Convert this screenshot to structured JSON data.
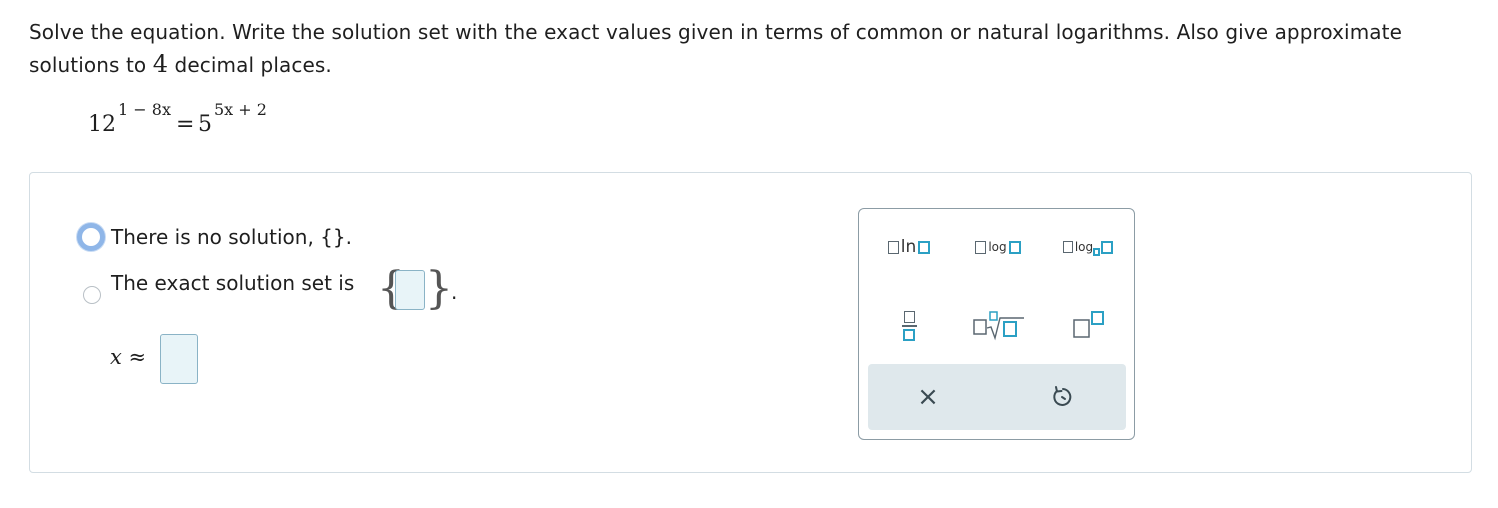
{
  "question": {
    "text_part1": "Solve the equation. Write the solution set with the exact values given in terms of common or natural logarithms. Also give approximate solutions to ",
    "decimal_count": "4",
    "text_part2": " decimal places."
  },
  "equation": {
    "left_base": "12",
    "left_exponent": "1 − 8x",
    "equals": "=",
    "right_base": "5",
    "right_exponent": "5x + 2"
  },
  "options": [
    {
      "label": "There is no solution, {}.",
      "selected": false,
      "focused": true
    },
    {
      "label": "The exact solution set is",
      "selected": false,
      "focused": false
    }
  ],
  "solution_set": {
    "value": "",
    "trailing": "."
  },
  "approx": {
    "label": "x ≈",
    "value": ""
  },
  "palette": {
    "buttons": [
      {
        "name": "ln-button",
        "label": "ln"
      },
      {
        "name": "log-button",
        "label": "log"
      },
      {
        "name": "log-base-button",
        "label": "log"
      },
      {
        "name": "fraction-button",
        "label": ""
      },
      {
        "name": "nth-root-button",
        "label": ""
      },
      {
        "name": "superscript-button",
        "label": ""
      }
    ],
    "clear_icon": "×",
    "undo_icon": "undo-icon"
  },
  "colors": {
    "input_fill": "#e8f4f8",
    "input_border": "#8ab3c6",
    "accent_teal": "#2ba0c4",
    "focus_ring": "#8fb6e8",
    "palette_footer": "#dfe8ec"
  }
}
